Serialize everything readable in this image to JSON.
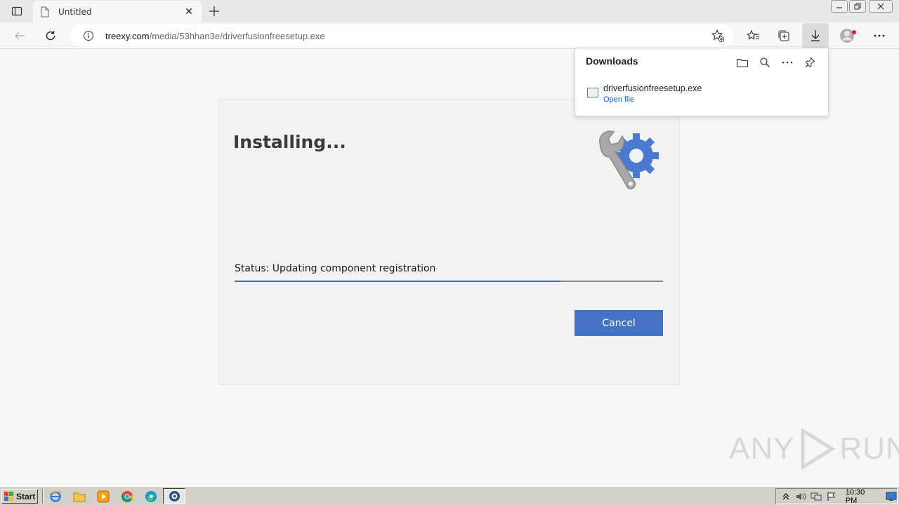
{
  "browser": {
    "tab_title": "Untitled",
    "address": {
      "host": "treexy.com",
      "path": "/media/53hhan3e/driverfusionfreesetup.exe"
    }
  },
  "downloads_panel": {
    "title": "Downloads",
    "items": [
      {
        "filename": "driverfusionfreesetup.exe",
        "action": "Open file"
      }
    ]
  },
  "installer": {
    "heading": "Installing...",
    "status": "Status: Updating component registration",
    "progress_percent": 76,
    "cancel_label": "Cancel",
    "accent_color": "#4472c4"
  },
  "watermark": {
    "left": "ANY",
    "right": "RUN"
  },
  "taskbar": {
    "start_label": "Start",
    "clock": "10:30 PM"
  }
}
